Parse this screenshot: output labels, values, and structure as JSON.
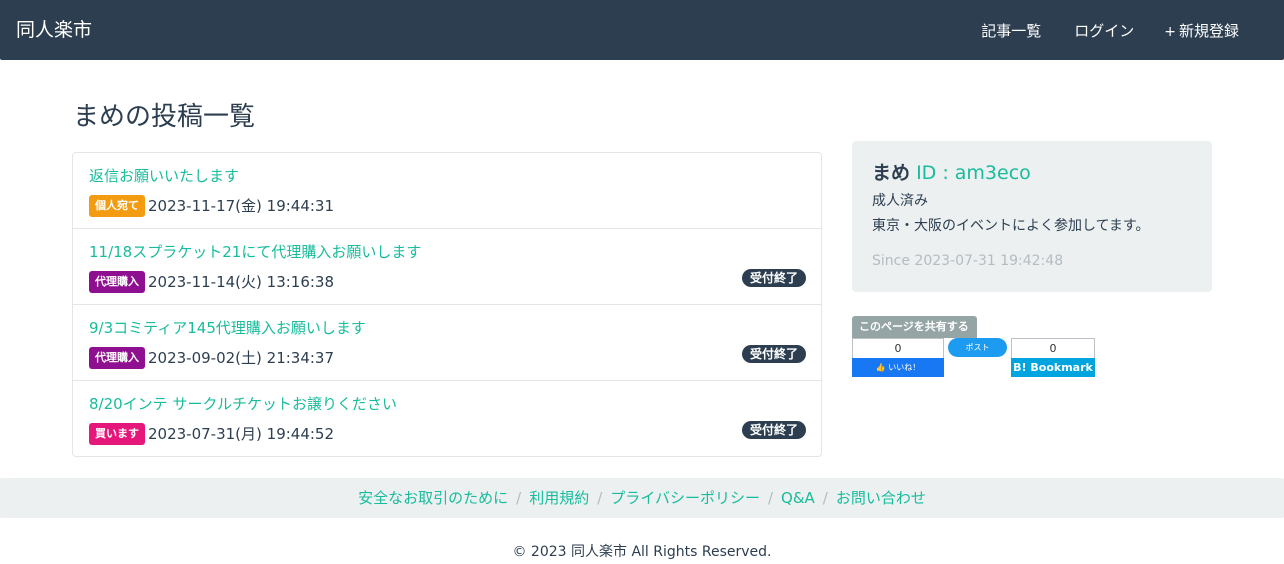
{
  "navbar": {
    "brand": "同人楽市",
    "links": [
      {
        "icon": "",
        "label": "記事一覧"
      },
      {
        "icon": "",
        "label": "ログイン"
      },
      {
        "icon": "+",
        "label": "新規登録"
      }
    ]
  },
  "page_title": "まめの投稿一覧",
  "posts": [
    {
      "title": "返信お願いいたします",
      "tag": "個人宛て",
      "tag_color": "#f39c12",
      "date": "2023-11-17(金) 19:44:31",
      "status": ""
    },
    {
      "title": "11/18スプラケット21にて代理購入お願いします",
      "tag": "代理購入",
      "tag_color": "#8e0f8f",
      "date": "2023-11-14(火) 13:16:38",
      "status": "受付終了"
    },
    {
      "title": "9/3コミティア145代理購入お願いします",
      "tag": "代理購入",
      "tag_color": "#8e0f8f",
      "date": "2023-09-02(土) 21:34:37",
      "status": "受付終了"
    },
    {
      "title": "8/20インテ サークルチケットお譲りください",
      "tag": "買います",
      "tag_color": "#e6177a",
      "date": "2023-07-31(月) 19:44:52",
      "status": "受付終了"
    }
  ],
  "profile": {
    "icon": "",
    "name": "まめ",
    "id_text": "ID : am3eco",
    "line1": "成人済み",
    "line2": "東京・大阪のイベントによく参加してます。",
    "since_icon": "",
    "since": "Since 2023-07-31 19:42:48"
  },
  "share": {
    "label": "このページを共有する",
    "fb_count": "0",
    "fb_label": "👍 いいね！",
    "tw_label": "ポスト",
    "hb_count": "0",
    "hb_label": "B! Bookmark"
  },
  "footer": {
    "links": [
      "安全なお取引のために",
      "利用規約",
      "プライバシーポリシー",
      "Q&A",
      "お問い合わせ"
    ],
    "separator": "/",
    "copyright": "© 2023 同人楽市 All Rights Reserved."
  },
  "colors": {
    "navbar_bg": "#2c3e50",
    "accent": "#18bc9c",
    "panel_bg": "#ecf0f1"
  }
}
